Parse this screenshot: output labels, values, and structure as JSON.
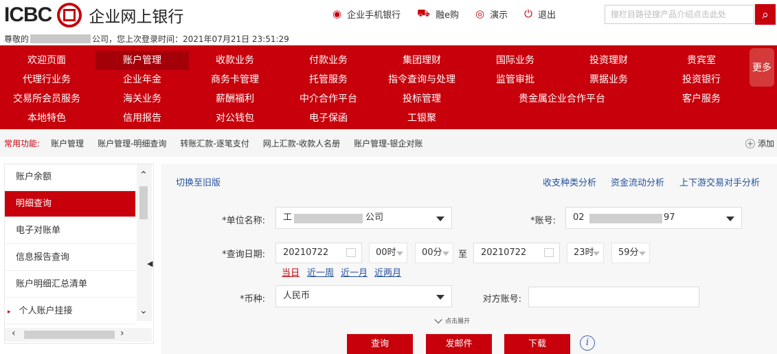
{
  "header": {
    "logo_text": "ICBC",
    "site_name": "企业网上银行",
    "top_links": [
      {
        "label": "企业手机银行",
        "icon": "mobile-bank-icon",
        "glyph": "◉"
      },
      {
        "label": "融e购",
        "icon": "cart-icon",
        "glyph": "⛟"
      },
      {
        "label": "演示",
        "icon": "eye-icon",
        "glyph": "◎"
      },
      {
        "label": "退出",
        "icon": "power-icon",
        "glyph": "⏻"
      }
    ],
    "search_placeholder": "搜栏目路径搜产品介绍点击此处",
    "greeting_prefix": "尊敬的",
    "greeting_suffix": "公司，您上次登录时间：2021年07月21日 23:51:29"
  },
  "nav": {
    "items": [
      "欢迎页面",
      "账户管理",
      "收款业务",
      "付款业务",
      "集团理财",
      "国际业务",
      "投资理财",
      "贵宾室",
      "代理行业务",
      "企业年金",
      "商务卡管理",
      "托管服务",
      "指令查询与处理",
      "监管审批",
      "票据业务",
      "投资银行",
      "交易所会员服务",
      "海关业务",
      "薪酬福利",
      "中介合作平台",
      "投标管理",
      "贵金属企业合作平台",
      "客户服务",
      "本地特色",
      "信用报告",
      "对公钱包",
      "电子保函",
      "工银聚"
    ],
    "more": "更多",
    "active_index": 1
  },
  "common": {
    "label": "常用功能:",
    "links": [
      "账户管理",
      "账户管理-明细查询",
      "转账汇款-逐笔支付",
      "网上汇款-收款人名册",
      "账户管理-银企对账"
    ],
    "add": "添加"
  },
  "sidebar": {
    "items": [
      "账户余额",
      "明细查询",
      "电子对账单",
      "信息报告查询",
      "账户明细汇总清单",
      "个人账户挂接"
    ],
    "active_index": 1
  },
  "main": {
    "switch_old": "切换至旧版",
    "analysis_links": [
      "收支种类分析",
      "资金流动分析",
      "上下游交易对手分析"
    ],
    "unit_label": "*单位名称:",
    "unit_prefix": "工",
    "unit_suffix": "公司",
    "account_label": "*账号:",
    "account_prefix": "02",
    "account_suffix": "97",
    "date_label": "*查询日期:",
    "start_date": "20210722",
    "start_hour": "00时",
    "start_minute": "00分",
    "to": "至",
    "end_date": "20210722",
    "end_hour": "23时",
    "end_minute": "59分",
    "quick_ranges": [
      "当日",
      "近一周",
      "近一月",
      "近两月"
    ],
    "quick_active": 0,
    "currency_label": "*币种:",
    "currency_value": "人民币",
    "counterparty_label": "对方账号:",
    "counterparty_value": "",
    "expand": "点击展开",
    "buttons": [
      "查询",
      "发邮件",
      "下载"
    ]
  },
  "colors": {
    "brand": "#c7000b",
    "link": "#224f9c"
  }
}
